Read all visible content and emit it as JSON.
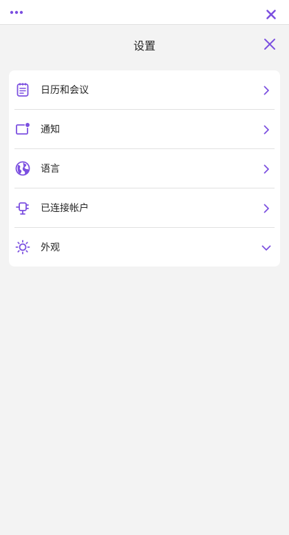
{
  "colors": {
    "accent": "#7b4fe0",
    "background": "#f3f3f3",
    "card": "#ffffff"
  },
  "topbar": {
    "more_icon": "more-horizontal-icon",
    "close_icon": "close-icon"
  },
  "header": {
    "title": "设置",
    "close_icon": "close-icon"
  },
  "settings": {
    "items": [
      {
        "label": "日历和会议",
        "icon": "calendar-clipboard-icon",
        "indicator": "chevron-right"
      },
      {
        "label": "通知",
        "icon": "notification-window-icon",
        "indicator": "chevron-right"
      },
      {
        "label": "语言",
        "icon": "globe-icon",
        "indicator": "chevron-right"
      },
      {
        "label": "已连接帐户",
        "icon": "connector-plug-icon",
        "indicator": "chevron-right"
      },
      {
        "label": "外观",
        "icon": "sun-brightness-icon",
        "indicator": "chevron-down"
      }
    ]
  }
}
